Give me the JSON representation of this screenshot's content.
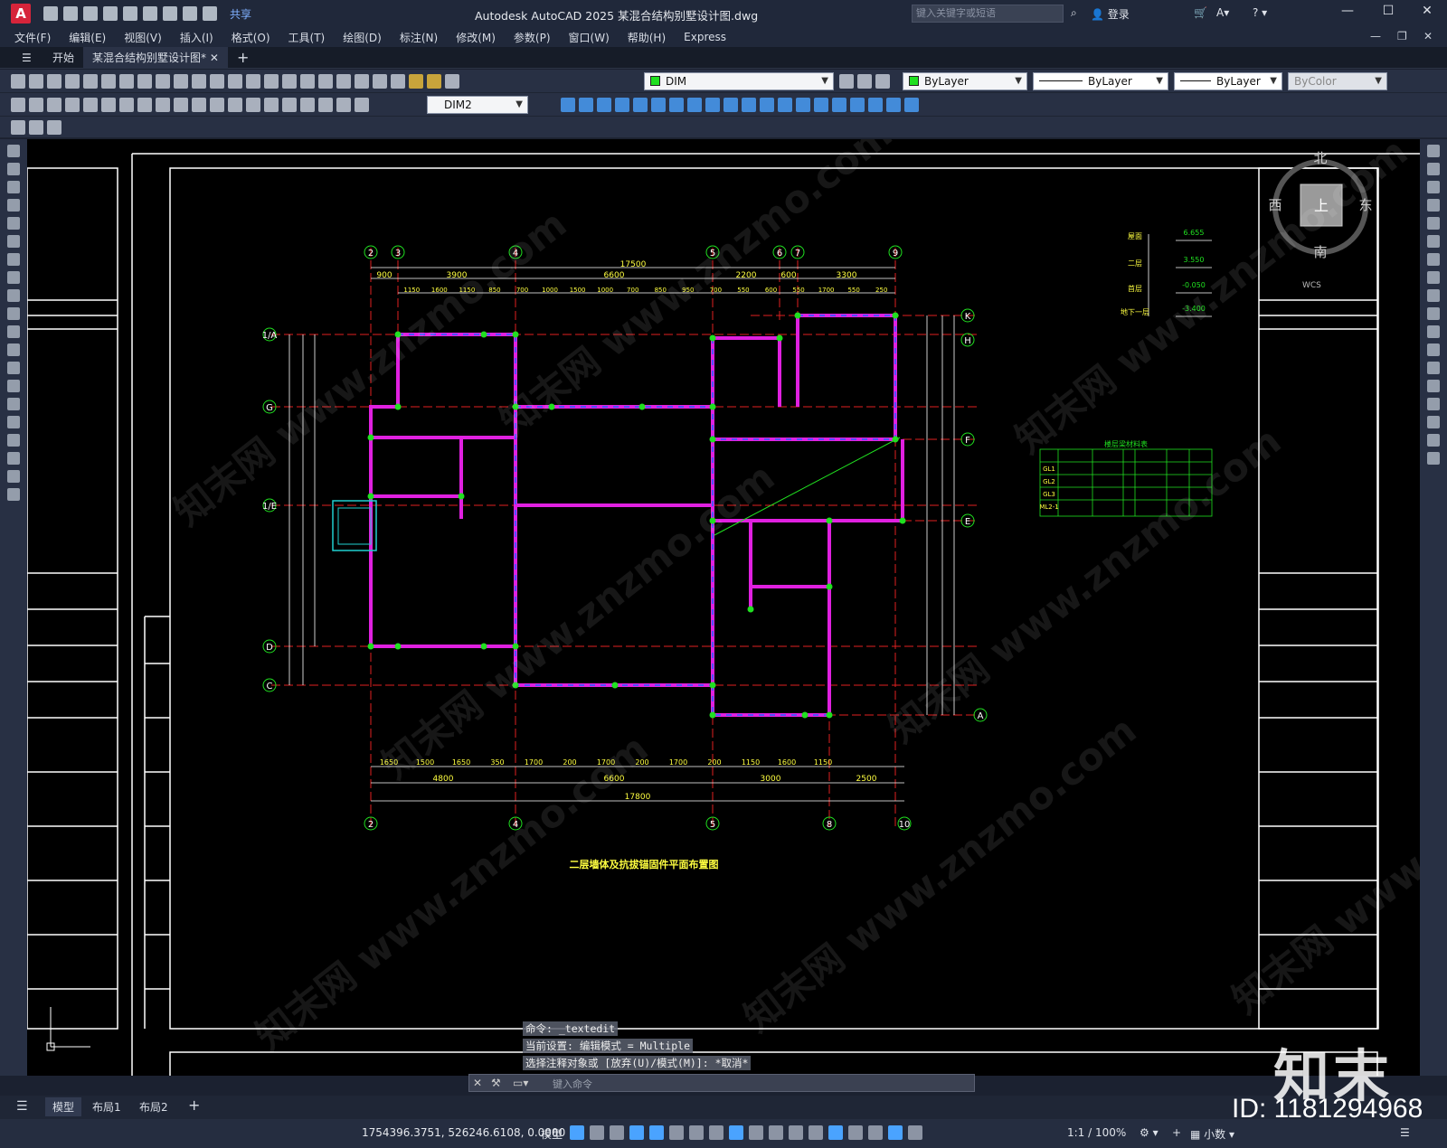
{
  "titlebar": {
    "logo": "A",
    "share_label": "共享",
    "app_title": "Autodesk AutoCAD 2025    某混合结构别墅设计图.dwg",
    "search_placeholder": "键入关键字或短语",
    "login_label": "登录"
  },
  "menu": {
    "items": [
      "文件(F)",
      "编辑(E)",
      "视图(V)",
      "插入(I)",
      "格式(O)",
      "工具(T)",
      "绘图(D)",
      "标注(N)",
      "修改(M)",
      "参数(P)",
      "窗口(W)",
      "帮助(H)",
      "Express"
    ]
  },
  "tabs": {
    "start": "开始",
    "doc": "某混合结构别墅设计图*"
  },
  "toolbar": {
    "layer_name": "DIM",
    "color": "ByLayer",
    "linetype": "ByLayer",
    "lineweight": "ByLayer",
    "plotstyle": "ByColor",
    "dimstyle": "DIM2"
  },
  "viewcube": {
    "north": "北",
    "south": "南",
    "east": "东",
    "west": "西",
    "top": "上",
    "wcs": "WCS"
  },
  "drawing": {
    "title": "二层墙体及抗拔锚固件平面布置图",
    "grid_top": [
      "2",
      "3",
      "4",
      "5",
      "6",
      "7",
      "9"
    ],
    "grid_bottom": [
      "2",
      "4",
      "5",
      "8",
      "10"
    ],
    "grid_right": [
      "K",
      "H",
      "F",
      "E",
      "A"
    ],
    "grid_left": [
      "1/A",
      "G",
      "1/E",
      "D",
      "C"
    ],
    "dims_top_total": "17500",
    "dims_top_row1": [
      "900",
      "3900",
      "6600",
      "2200",
      "600",
      "3300"
    ],
    "dims_top_row2": [
      "1150",
      "1600",
      "1150",
      "850",
      "700",
      "1000",
      "1500",
      "1000",
      "700",
      "850",
      "950",
      "700",
      "550",
      "600",
      "550",
      "1700",
      "550",
      "250"
    ],
    "dims_bottom_row1": [
      "1650",
      "1500",
      "1650",
      "350",
      "1700",
      "200",
      "1700",
      "200",
      "1700",
      "200",
      "1150",
      "1600",
      "1150"
    ],
    "dims_bottom_row2": [
      "4800",
      "6600",
      "3000",
      "2500"
    ],
    "dims_bottom_total": "17800",
    "elev_labels": [
      "屋面",
      "二层",
      "首层",
      "地下一层"
    ],
    "elev_values": [
      "6.655",
      "3.550",
      "-0.050",
      "-3.400"
    ],
    "beam_table_title": "楼层梁材料表",
    "beam_rows": [
      "GL1",
      "GL2",
      "GL3",
      "ML2-1"
    ]
  },
  "command": {
    "line1": "命令: _textedit",
    "line2": "当前设置: 编辑模式 = Multiple",
    "line3": "选择注释对象或 [放弃(U)/模式(M)]: *取消*",
    "placeholder": "键入命令"
  },
  "layouts": {
    "model": "模型",
    "layout1": "布局1",
    "layout2": "布局2"
  },
  "statusbar": {
    "coords": "1754396.3751, 526246.6108, 0.0000",
    "mode": "模型",
    "scale": "1:1 / 100%",
    "units": "小数"
  },
  "watermark": {
    "logo_text": "知末",
    "id_text": "ID: 1181294968"
  }
}
